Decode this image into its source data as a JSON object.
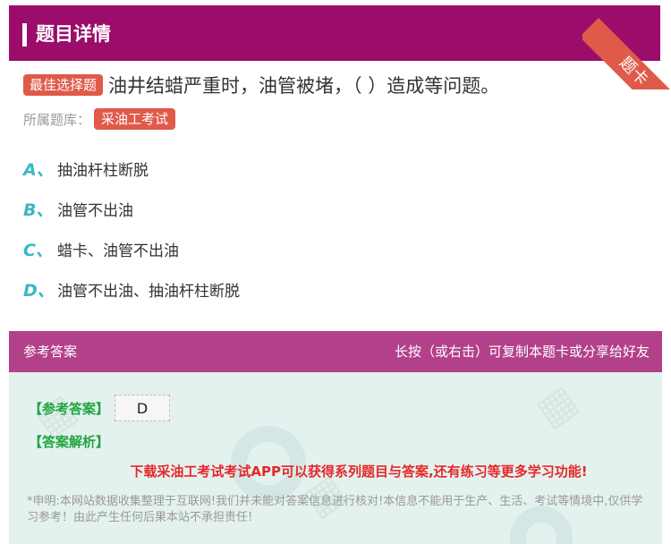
{
  "header": {
    "title": "题目详情",
    "ribbon": "题卡"
  },
  "question": {
    "type_tag": "最佳选择题",
    "text": "油井结蜡严重时，油管被堵，（ ）造成等问题。",
    "bank_label": "所属题库：",
    "bank_name": "采油工考试"
  },
  "options": [
    {
      "letter": "A、",
      "text": "抽油杆柱断脱"
    },
    {
      "letter": "B、",
      "text": "油管不出油"
    },
    {
      "letter": "C、",
      "text": "蜡卡、油管不出油"
    },
    {
      "letter": "D、",
      "text": "油管不出油、抽油杆柱断脱"
    }
  ],
  "answer": {
    "head_left": "参考答案",
    "head_right": "长按（或右击）可复制本题卡或分享给好友",
    "ref_label": "【参考答案】",
    "ref_value": "D",
    "analysis_label": "【答案解析】",
    "promo": "下载采油工考试考试APP可以获得系列题目与答案,还有练习等更多学习功能!",
    "disclaimer": "*申明:本网站数据收集整理于互联网!我们并未能对答案信息进行核对!本信息不能用于生产、生活、考试等情境中,仅供学习参考！由此产生任何后果本站不承担责任!"
  },
  "colors": {
    "header": "#9b0c6b",
    "accent_red": "#e05a4a",
    "option_letter": "#3ab7c6",
    "answer_head": "#b2408a",
    "answer_bg": "#e4f2ef"
  }
}
